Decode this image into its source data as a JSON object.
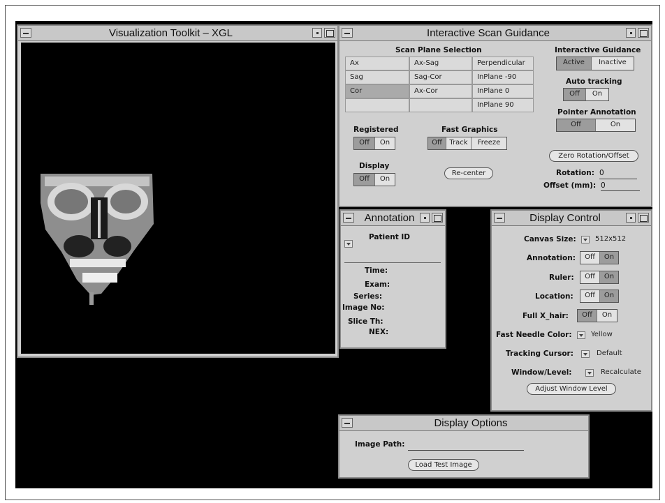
{
  "viz_window": {
    "title": "Visualization Toolkit – XGL"
  },
  "scan_window": {
    "title": "Interactive Scan Guidance",
    "plane_header": "Scan Plane Selection",
    "plane_grid": [
      [
        "Ax",
        "Ax-Sag",
        "Perpendicular"
      ],
      [
        "Sag",
        "Sag-Cor",
        "InPlane -90"
      ],
      [
        "Cor",
        "Ax-Cor",
        "InPlane 0"
      ],
      [
        "",
        "",
        "InPlane 90"
      ]
    ],
    "guidance_header": "Interactive Guidance",
    "guidance_options": [
      "Active",
      "Inactive"
    ],
    "autotrack_header": "Auto tracking",
    "autotrack_options": [
      "Off",
      "On"
    ],
    "pointer_header": "Pointer Annotation",
    "pointer_options": [
      "Off",
      "On"
    ],
    "registered_header": "Registered",
    "registered_options": [
      "Off",
      "On"
    ],
    "fast_header": "Fast Graphics",
    "fast_options": [
      "Off",
      "Track",
      "Freeze"
    ],
    "display_header": "Display",
    "display_options": [
      "Off",
      "On"
    ],
    "recenter_label": "Re-center",
    "zero_label": "Zero Rotation/Offset",
    "rotation_label": "Rotation:",
    "rotation_value": "0",
    "offset_label": "Offset (mm):",
    "offset_value": "0"
  },
  "annotation_window": {
    "title": "Annotation",
    "patient_id_label": "Patient ID",
    "fields": [
      "Time:",
      "Exam:",
      "Series:",
      "Image No:",
      "Slice Th:",
      "NEX:"
    ]
  },
  "display_control": {
    "title": "Display Control",
    "canvas_label": "Canvas Size:",
    "canvas_value": "512x512",
    "annotation_label": "Annotation:",
    "ruler_label": "Ruler:",
    "location_label": "Location:",
    "xhair_label": "Full X_hair:",
    "onoff": [
      "Off",
      "On"
    ],
    "needle_label": "Fast Needle Color:",
    "needle_value": "Yellow",
    "cursor_label": "Tracking Cursor:",
    "cursor_value": "Default",
    "wl_label": "Window/Level:",
    "wl_value": "Recalculate",
    "adjust_label": "Adjust Window Level"
  },
  "display_options": {
    "title": "Display Options",
    "path_label": "Image Path:",
    "load_label": "Load Test Image"
  }
}
